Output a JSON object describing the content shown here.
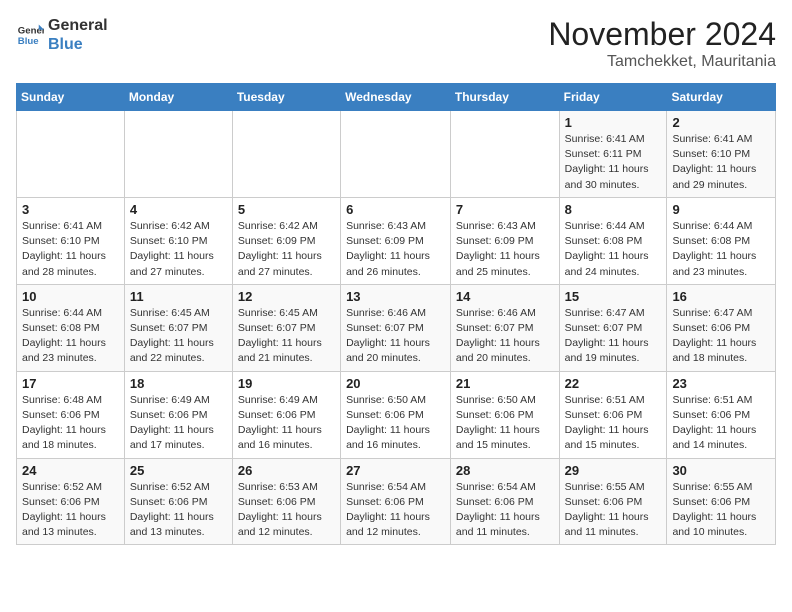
{
  "header": {
    "logo_general": "General",
    "logo_blue": "Blue",
    "month": "November 2024",
    "location": "Tamchekket, Mauritania"
  },
  "days_of_week": [
    "Sunday",
    "Monday",
    "Tuesday",
    "Wednesday",
    "Thursday",
    "Friday",
    "Saturday"
  ],
  "weeks": [
    [
      {
        "day": "",
        "info": ""
      },
      {
        "day": "",
        "info": ""
      },
      {
        "day": "",
        "info": ""
      },
      {
        "day": "",
        "info": ""
      },
      {
        "day": "",
        "info": ""
      },
      {
        "day": "1",
        "info": "Sunrise: 6:41 AM\nSunset: 6:11 PM\nDaylight: 11 hours and 30 minutes."
      },
      {
        "day": "2",
        "info": "Sunrise: 6:41 AM\nSunset: 6:10 PM\nDaylight: 11 hours and 29 minutes."
      }
    ],
    [
      {
        "day": "3",
        "info": "Sunrise: 6:41 AM\nSunset: 6:10 PM\nDaylight: 11 hours and 28 minutes."
      },
      {
        "day": "4",
        "info": "Sunrise: 6:42 AM\nSunset: 6:10 PM\nDaylight: 11 hours and 27 minutes."
      },
      {
        "day": "5",
        "info": "Sunrise: 6:42 AM\nSunset: 6:09 PM\nDaylight: 11 hours and 27 minutes."
      },
      {
        "day": "6",
        "info": "Sunrise: 6:43 AM\nSunset: 6:09 PM\nDaylight: 11 hours and 26 minutes."
      },
      {
        "day": "7",
        "info": "Sunrise: 6:43 AM\nSunset: 6:09 PM\nDaylight: 11 hours and 25 minutes."
      },
      {
        "day": "8",
        "info": "Sunrise: 6:44 AM\nSunset: 6:08 PM\nDaylight: 11 hours and 24 minutes."
      },
      {
        "day": "9",
        "info": "Sunrise: 6:44 AM\nSunset: 6:08 PM\nDaylight: 11 hours and 23 minutes."
      }
    ],
    [
      {
        "day": "10",
        "info": "Sunrise: 6:44 AM\nSunset: 6:08 PM\nDaylight: 11 hours and 23 minutes."
      },
      {
        "day": "11",
        "info": "Sunrise: 6:45 AM\nSunset: 6:07 PM\nDaylight: 11 hours and 22 minutes."
      },
      {
        "day": "12",
        "info": "Sunrise: 6:45 AM\nSunset: 6:07 PM\nDaylight: 11 hours and 21 minutes."
      },
      {
        "day": "13",
        "info": "Sunrise: 6:46 AM\nSunset: 6:07 PM\nDaylight: 11 hours and 20 minutes."
      },
      {
        "day": "14",
        "info": "Sunrise: 6:46 AM\nSunset: 6:07 PM\nDaylight: 11 hours and 20 minutes."
      },
      {
        "day": "15",
        "info": "Sunrise: 6:47 AM\nSunset: 6:07 PM\nDaylight: 11 hours and 19 minutes."
      },
      {
        "day": "16",
        "info": "Sunrise: 6:47 AM\nSunset: 6:06 PM\nDaylight: 11 hours and 18 minutes."
      }
    ],
    [
      {
        "day": "17",
        "info": "Sunrise: 6:48 AM\nSunset: 6:06 PM\nDaylight: 11 hours and 18 minutes."
      },
      {
        "day": "18",
        "info": "Sunrise: 6:49 AM\nSunset: 6:06 PM\nDaylight: 11 hours and 17 minutes."
      },
      {
        "day": "19",
        "info": "Sunrise: 6:49 AM\nSunset: 6:06 PM\nDaylight: 11 hours and 16 minutes."
      },
      {
        "day": "20",
        "info": "Sunrise: 6:50 AM\nSunset: 6:06 PM\nDaylight: 11 hours and 16 minutes."
      },
      {
        "day": "21",
        "info": "Sunrise: 6:50 AM\nSunset: 6:06 PM\nDaylight: 11 hours and 15 minutes."
      },
      {
        "day": "22",
        "info": "Sunrise: 6:51 AM\nSunset: 6:06 PM\nDaylight: 11 hours and 15 minutes."
      },
      {
        "day": "23",
        "info": "Sunrise: 6:51 AM\nSunset: 6:06 PM\nDaylight: 11 hours and 14 minutes."
      }
    ],
    [
      {
        "day": "24",
        "info": "Sunrise: 6:52 AM\nSunset: 6:06 PM\nDaylight: 11 hours and 13 minutes."
      },
      {
        "day": "25",
        "info": "Sunrise: 6:52 AM\nSunset: 6:06 PM\nDaylight: 11 hours and 13 minutes."
      },
      {
        "day": "26",
        "info": "Sunrise: 6:53 AM\nSunset: 6:06 PM\nDaylight: 11 hours and 12 minutes."
      },
      {
        "day": "27",
        "info": "Sunrise: 6:54 AM\nSunset: 6:06 PM\nDaylight: 11 hours and 12 minutes."
      },
      {
        "day": "28",
        "info": "Sunrise: 6:54 AM\nSunset: 6:06 PM\nDaylight: 11 hours and 11 minutes."
      },
      {
        "day": "29",
        "info": "Sunrise: 6:55 AM\nSunset: 6:06 PM\nDaylight: 11 hours and 11 minutes."
      },
      {
        "day": "30",
        "info": "Sunrise: 6:55 AM\nSunset: 6:06 PM\nDaylight: 11 hours and 10 minutes."
      }
    ]
  ]
}
